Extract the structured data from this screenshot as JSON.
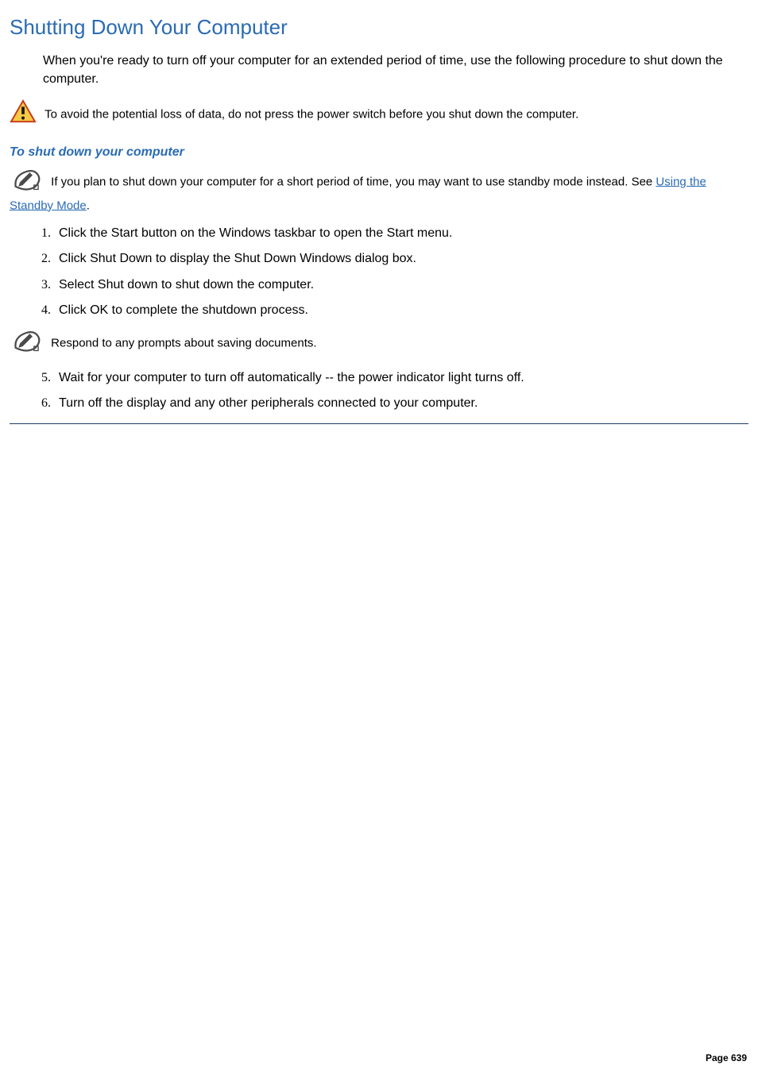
{
  "title": "Shutting Down Your Computer",
  "intro": "When you're ready to turn off your computer for an extended period of time, use the following procedure to shut down the computer.",
  "warning_callout": "To avoid the potential loss of data, do not press the power switch before you shut down the computer.",
  "subheading": "To shut down your computer",
  "note1_part1": "If you plan to shut down your computer for a short period of time, you may want to use standby mode instead. See ",
  "note1_link": "Using the Standby Mode",
  "note1_part2": ".",
  "steps_group1": [
    "Click the Start button on the Windows taskbar to open the Start menu.",
    "Click Shut Down to display the Shut Down Windows dialog box.",
    "Select Shut down to shut down the computer.",
    "Click OK to complete the shutdown process."
  ],
  "mid_note": "Respond to any prompts about saving documents.",
  "steps_group2": [
    "Wait for your computer to turn off automatically -- the power indicator light turns off.",
    "Turn off the display and any other peripherals connected to your computer."
  ],
  "footer": "Page 639"
}
